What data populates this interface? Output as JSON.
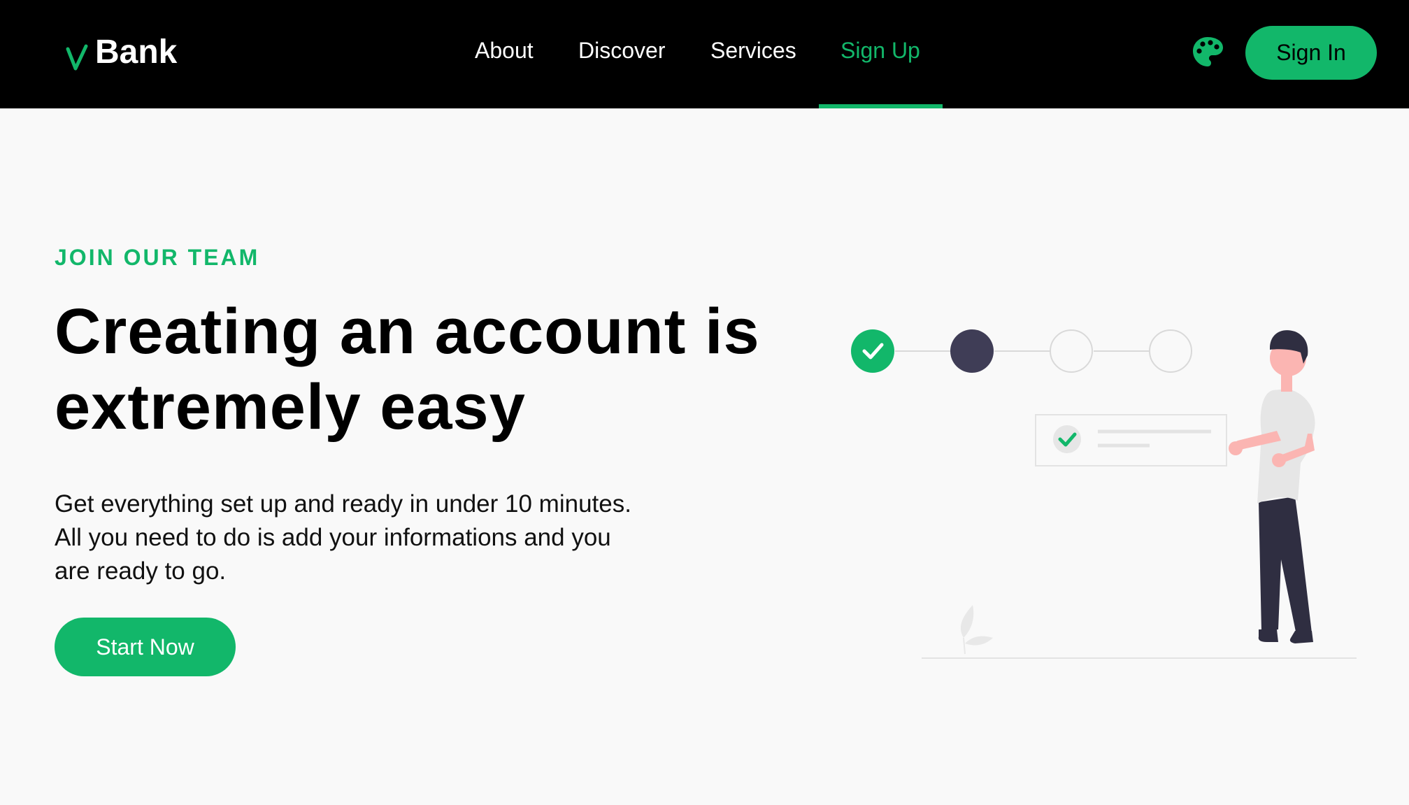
{
  "brand": {
    "name": "Bank",
    "logo_icon": "v-check-icon",
    "accent_color": "#12b76a"
  },
  "nav": {
    "items": [
      {
        "label": "About",
        "active": false
      },
      {
        "label": "Discover",
        "active": false
      },
      {
        "label": "Services",
        "active": false
      },
      {
        "label": "Sign Up",
        "active": true
      }
    ]
  },
  "header_actions": {
    "theme_icon": "palette-icon",
    "signin_label": "Sign In"
  },
  "hero": {
    "eyebrow": "JOIN OUR TEAM",
    "headline_line1": "Creating an account is",
    "headline_line2": "extremely easy",
    "description_line1": "Get everything set up and ready in under 10 minutes.",
    "description_line2": "All you need to do is add your informations and you",
    "description_line3": "are ready to go.",
    "cta_label": "Start Now"
  },
  "illustration": {
    "steps": [
      {
        "state": "completed"
      },
      {
        "state": "current"
      },
      {
        "state": "upcoming"
      },
      {
        "state": "upcoming"
      }
    ],
    "colors": {
      "completed": "#12b76a",
      "current": "#3f3d56",
      "upcoming_border": "#d9d9d9"
    }
  }
}
